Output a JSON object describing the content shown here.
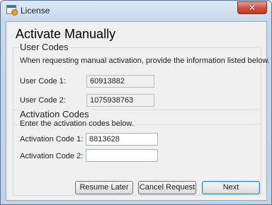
{
  "window": {
    "title": "License",
    "close_glyph": "✕"
  },
  "heading": "Activate Manually",
  "user_codes": {
    "title": "User Codes",
    "description": "When requesting manual activation, provide the information listed below.",
    "fields": [
      {
        "label": "User Code 1:",
        "value": "60913882"
      },
      {
        "label": "User Code 2:",
        "value": "1075938763"
      }
    ]
  },
  "activation_codes": {
    "title": "Activation Codes",
    "description": "Enter the activation codes below.",
    "fields": [
      {
        "label": "Activation Code 1:",
        "value": "8813628"
      },
      {
        "label": "Activation Code 2:",
        "value": ""
      }
    ]
  },
  "buttons": {
    "resume_later": "Resume Later",
    "cancel_request": "Cancel Request",
    "next": "Next"
  },
  "icons": {
    "app": "license-app-icon",
    "close": "close-icon"
  }
}
